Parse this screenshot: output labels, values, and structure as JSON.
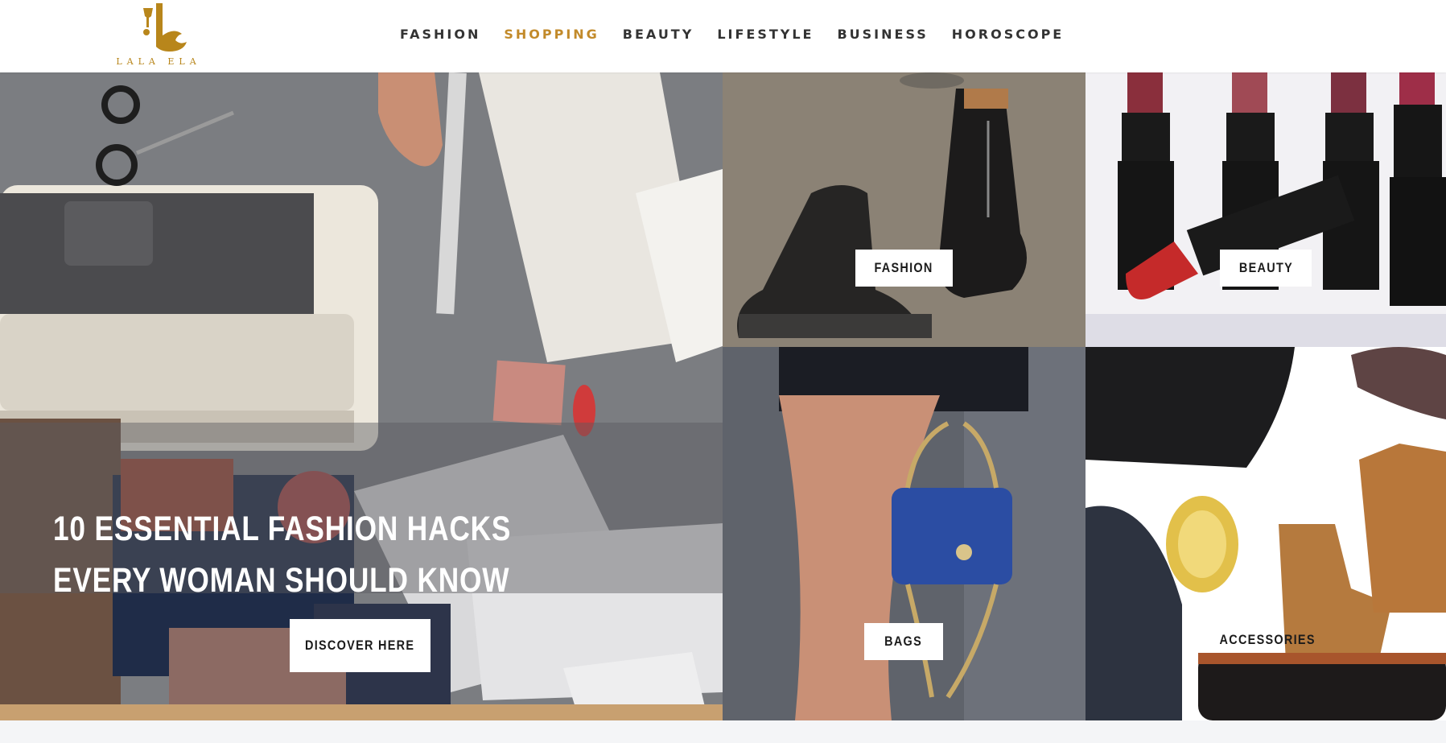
{
  "header": {
    "logo_text": "LALA ELA",
    "nav": [
      {
        "label": "FASHION",
        "active": false
      },
      {
        "label": "SHOPPING",
        "active": true
      },
      {
        "label": "BEAUTY",
        "active": false
      },
      {
        "label": "LIFESTYLE",
        "active": false
      },
      {
        "label": "BUSINESS",
        "active": false
      },
      {
        "label": "HOROSCOPE",
        "active": false
      }
    ]
  },
  "hero": {
    "title": "10 ESSENTIAL FASHION HACKS EVERY WOMAN SHOULD KNOW",
    "button_label": "DISCOVER HERE"
  },
  "categories": {
    "fashion": "FASHION",
    "beauty": "BEAUTY",
    "bags": "BAGS",
    "accessories": "ACCESSORIES"
  },
  "colors": {
    "accent": "#c28a2a",
    "nav_text": "#333333",
    "logo": "#b8861b"
  }
}
